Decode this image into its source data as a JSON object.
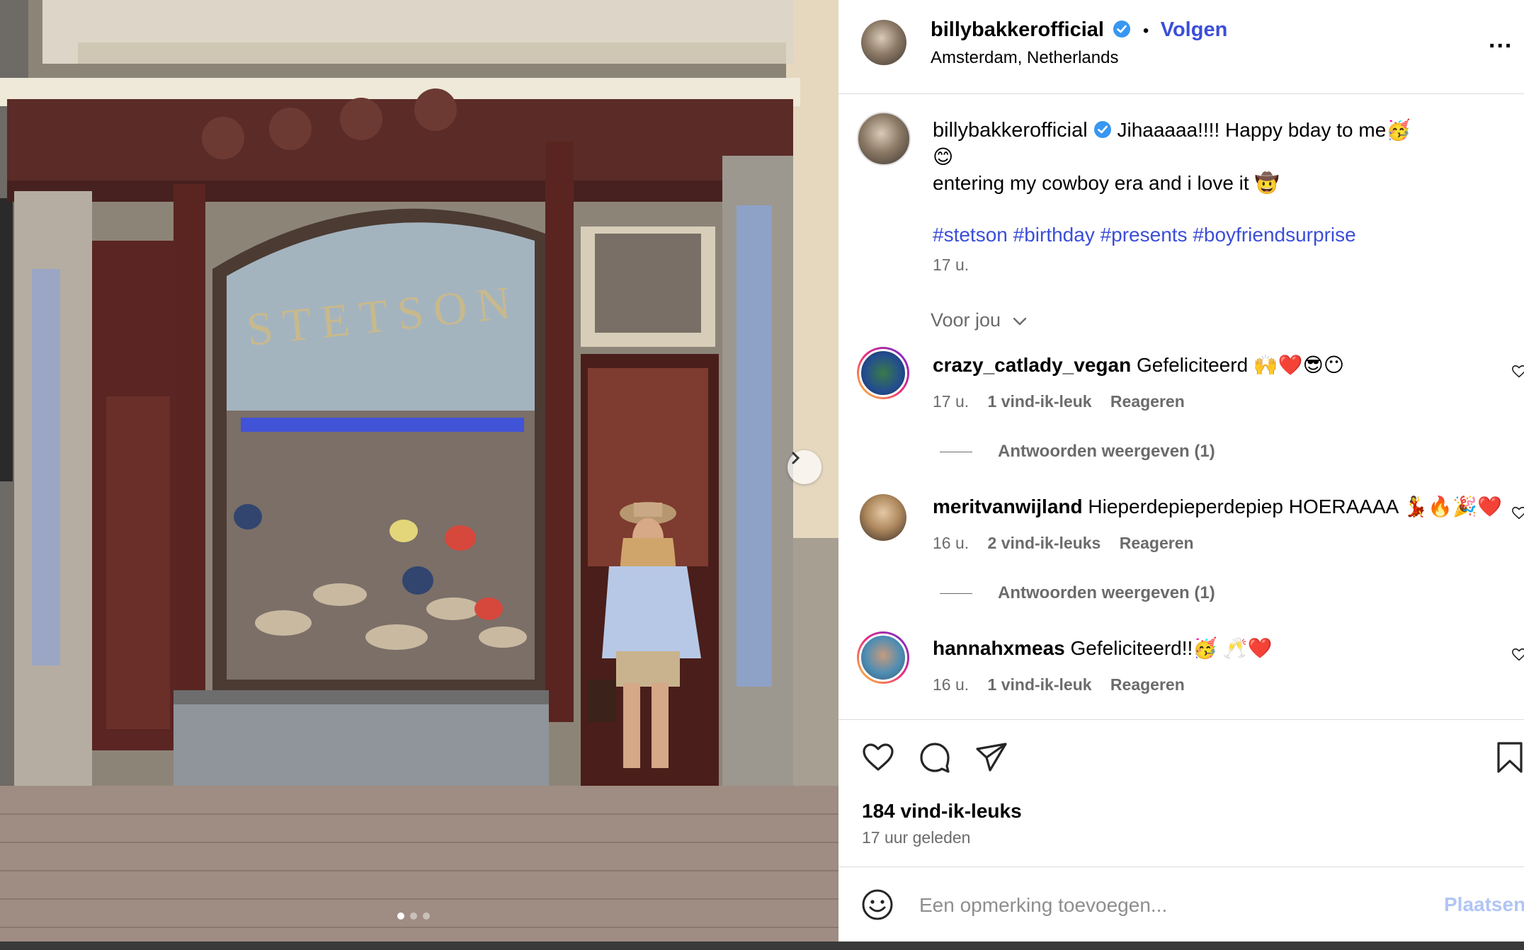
{
  "header": {
    "username": "billybakkerofficial",
    "separator": "•",
    "follow_label": "Volgen",
    "location": "Amsterdam, Netherlands",
    "more_label": "..."
  },
  "caption": {
    "username": "billybakkerofficial",
    "line1": "Jihaaaaa!!!! Happy bday to me🥳",
    "line2": "😊",
    "line3": "entering my cowboy era and i love it 🤠",
    "hashtags": "#stetson #birthday #presents #boyfriendsurprise",
    "time": "17 u."
  },
  "for_you_label": "Voor jou",
  "comments": [
    {
      "username": "crazy_catlady_vegan",
      "text": "Gefeliciteerd 🙌❤️😎😶",
      "time": "17 u.",
      "likes": "1 vind-ik-leuk",
      "reply_label": "Reageren",
      "view_replies": "Antwoorden weergeven (1)"
    },
    {
      "username": "meritvanwijland",
      "text": "Hieperdepieperdepiep HOERAAAA 💃🔥🎉❤️",
      "time": "16 u.",
      "likes": "2 vind-ik-leuks",
      "reply_label": "Reageren",
      "view_replies": "Antwoorden weergeven (1)"
    },
    {
      "username": "hannahxmeas",
      "text": "Gefeliciteerd!!🥳 🥂❤️",
      "time": "16 u.",
      "likes": "1 vind-ik-leuk",
      "reply_label": "Reageren"
    }
  ],
  "post": {
    "likes": "184 vind-ik-leuks",
    "time_ago": "17 uur geleden"
  },
  "composer": {
    "placeholder": "Een opmerking toevoegen...",
    "post_label": "Plaatsen"
  },
  "photo": {
    "shop_sign": "STETSON",
    "carousel_count": 3,
    "carousel_active": 1
  },
  "colors": {
    "link_blue": "#3b4ed8",
    "verified_blue": "#3897f0",
    "muted_text": "#6b6b6b"
  }
}
